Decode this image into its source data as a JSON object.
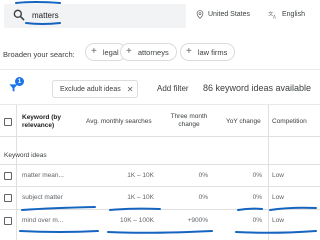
{
  "search": {
    "query": "matters"
  },
  "location": {
    "label": "United States"
  },
  "language": {
    "label": "English"
  },
  "broaden": {
    "label": "Broaden your search:",
    "chips": [
      "legal",
      "attorneys",
      "law firms"
    ]
  },
  "filters": {
    "badge_count": "1",
    "active_filter": "Exclude adult ideas",
    "add_filter_label": "Add filter",
    "ideas_available": "86 keyword ideas available"
  },
  "table": {
    "headers": {
      "keyword": "Keyword (by relevance)",
      "avg_searches": "Avg. monthly searches",
      "three_month": "Three month change",
      "yoy": "YoY change",
      "competition": "Competition"
    },
    "group_label": "Keyword ideas",
    "rows": [
      {
        "keyword": "matter mean...",
        "avg": "1K – 10K",
        "three_month": "0%",
        "yoy": "0%",
        "competition": "Low"
      },
      {
        "keyword": "subject matter",
        "avg": "1K – 10K",
        "three_month": "0%",
        "yoy": "0%",
        "competition": "Low"
      },
      {
        "keyword": "mind over m...",
        "avg": "10K – 100K",
        "three_month": "+900%",
        "yoy": "0%",
        "competition": "Low"
      }
    ]
  },
  "colors": {
    "accent": "#1a73e8",
    "annotation_ink": "#1565c0"
  },
  "icons": {
    "search": "search-icon",
    "location": "location-pin-icon",
    "language": "translate-icon",
    "filter": "filter-icon",
    "close": "close-icon",
    "plus": "plus-icon"
  }
}
